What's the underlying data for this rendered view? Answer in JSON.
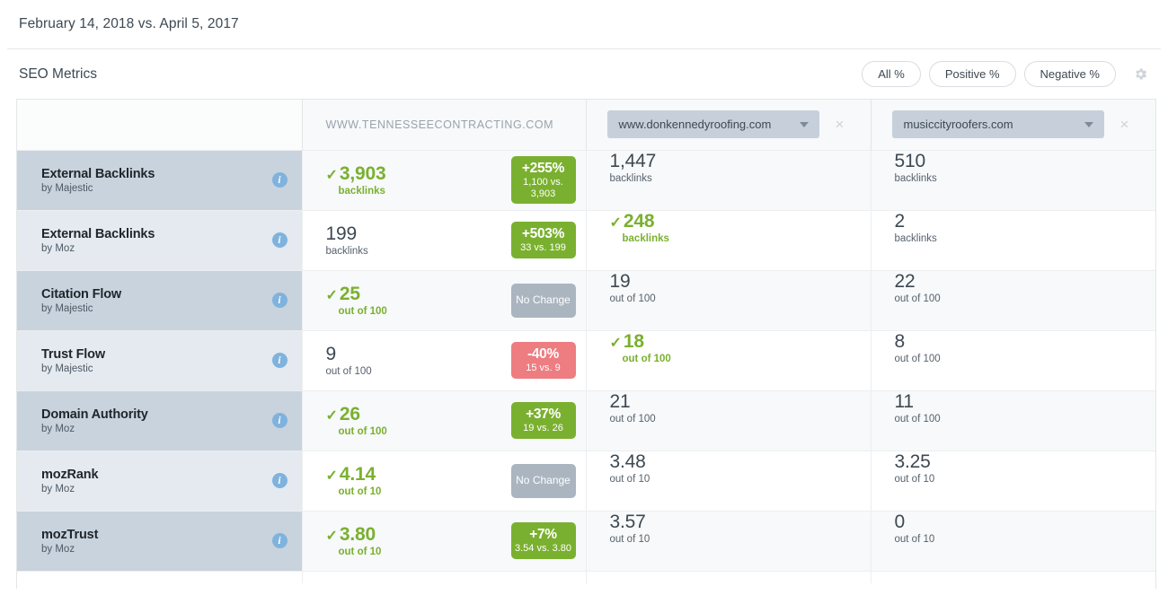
{
  "date_bar": {
    "text": "February 14, 2018 vs. April 5, 2017"
  },
  "section": {
    "title": "SEO Metrics",
    "filters": [
      {
        "label": "All %"
      },
      {
        "label": "Positive %"
      },
      {
        "label": "Negative %"
      }
    ],
    "settings_icon": "gear-icon"
  },
  "table": {
    "header": {
      "label_col": "",
      "main_site": "WWW.TENNESSEECONTRACTING.COM",
      "competitors": [
        {
          "value": "www.donkennedyroofing.com",
          "caret_icon": "chevron-down-icon",
          "remove_icon": "close-icon",
          "remove_label": "×"
        },
        {
          "value": "musiccityroofers.com",
          "caret_icon": "chevron-down-icon",
          "remove_icon": "close-icon",
          "remove_label": "×"
        }
      ]
    },
    "check_glyph": "✓",
    "rows": [
      {
        "metric": "External Backlinks",
        "source": "by Majestic",
        "info_icon": "info-icon",
        "info_glyph": "i",
        "main": {
          "value": "3,903",
          "unit": "backlinks",
          "highlight": true,
          "check": true
        },
        "badge": {
          "type": "up",
          "pct": "+255%",
          "sub": "1,100 vs. 3,903"
        },
        "competitors": [
          {
            "value": "1,447",
            "unit": "backlinks",
            "highlight": false,
            "check": false
          },
          {
            "value": "510",
            "unit": "backlinks",
            "highlight": false,
            "check": false
          }
        ]
      },
      {
        "metric": "External Backlinks",
        "source": "by Moz",
        "info_icon": "info-icon",
        "info_glyph": "i",
        "main": {
          "value": "199",
          "unit": "backlinks",
          "highlight": false,
          "check": false
        },
        "badge": {
          "type": "up",
          "pct": "+503%",
          "sub": "33 vs. 199"
        },
        "competitors": [
          {
            "value": "248",
            "unit": "backlinks",
            "highlight": true,
            "check": true
          },
          {
            "value": "2",
            "unit": "backlinks",
            "highlight": false,
            "check": false
          }
        ]
      },
      {
        "metric": "Citation Flow",
        "source": "by Majestic",
        "info_icon": "info-icon",
        "info_glyph": "i",
        "main": {
          "value": "25",
          "unit": "out of 100",
          "highlight": true,
          "check": true
        },
        "badge": {
          "type": "neutral",
          "pct": "",
          "sub": "",
          "flat": "No Change"
        },
        "competitors": [
          {
            "value": "19",
            "unit": "out of 100",
            "highlight": false,
            "check": false
          },
          {
            "value": "22",
            "unit": "out of 100",
            "highlight": false,
            "check": false
          }
        ]
      },
      {
        "metric": "Trust Flow",
        "source": "by Majestic",
        "info_icon": "info-icon",
        "info_glyph": "i",
        "main": {
          "value": "9",
          "unit": "out of 100",
          "highlight": false,
          "check": false
        },
        "badge": {
          "type": "down",
          "pct": "-40%",
          "sub": "15 vs. 9"
        },
        "competitors": [
          {
            "value": "18",
            "unit": "out of 100",
            "highlight": true,
            "check": true
          },
          {
            "value": "8",
            "unit": "out of 100",
            "highlight": false,
            "check": false
          }
        ]
      },
      {
        "metric": "Domain Authority",
        "source": "by Moz",
        "info_icon": "info-icon",
        "info_glyph": "i",
        "main": {
          "value": "26",
          "unit": "out of 100",
          "highlight": true,
          "check": true
        },
        "badge": {
          "type": "up",
          "pct": "+37%",
          "sub": "19 vs. 26"
        },
        "competitors": [
          {
            "value": "21",
            "unit": "out of 100",
            "highlight": false,
            "check": false
          },
          {
            "value": "11",
            "unit": "out of 100",
            "highlight": false,
            "check": false
          }
        ]
      },
      {
        "metric": "mozRank",
        "source": "by Moz",
        "info_icon": "info-icon",
        "info_glyph": "i",
        "main": {
          "value": "4.14",
          "unit": "out of 10",
          "highlight": true,
          "check": true
        },
        "badge": {
          "type": "neutral",
          "pct": "",
          "sub": "",
          "flat": "No Change"
        },
        "competitors": [
          {
            "value": "3.48",
            "unit": "out of 10",
            "highlight": false,
            "check": false
          },
          {
            "value": "3.25",
            "unit": "out of 10",
            "highlight": false,
            "check": false
          }
        ]
      },
      {
        "metric": "mozTrust",
        "source": "by Moz",
        "info_icon": "info-icon",
        "info_glyph": "i",
        "main": {
          "value": "3.80",
          "unit": "out of 10",
          "highlight": true,
          "check": true
        },
        "badge": {
          "type": "up",
          "pct": "+7%",
          "sub": "3.54 vs. 3.80"
        },
        "competitors": [
          {
            "value": "3.57",
            "unit": "out of 10",
            "highlight": false,
            "check": false
          },
          {
            "value": "0",
            "unit": "out of 10",
            "highlight": false,
            "check": false
          }
        ]
      }
    ]
  },
  "colors": {
    "positive": "#7ab02f",
    "negative": "#ed7d81",
    "neutral": "#aab5c0",
    "info": "#7fb3dd",
    "row_dark": "#c9d3dd",
    "row_light": "#e4eaef"
  }
}
